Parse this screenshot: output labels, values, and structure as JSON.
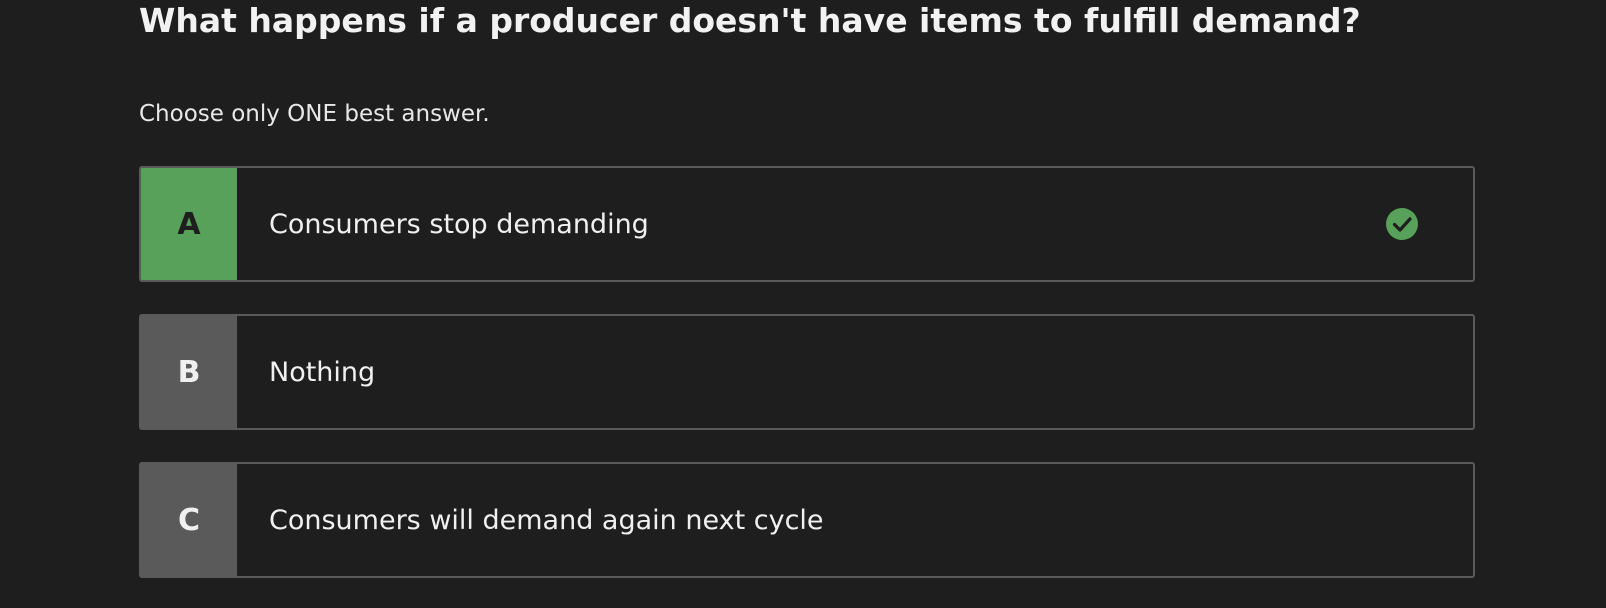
{
  "question": {
    "text": "What happens if a producer doesn't have items to fulfill demand?",
    "instruction": "Choose only ONE best answer."
  },
  "options": [
    {
      "letter": "A",
      "text": "Consumers stop demanding",
      "state": "correct",
      "icon": "check-circle-icon"
    },
    {
      "letter": "B",
      "text": "Nothing",
      "state": "default"
    },
    {
      "letter": "C",
      "text": "Consumers will demand again next cycle",
      "state": "default"
    }
  ],
  "colors": {
    "background": "#1e1e1e",
    "correct_green": "#58a15a",
    "letter_gray": "#5a5a5a",
    "border_gray": "#5a5a5a",
    "text": "#f0f0f0"
  }
}
